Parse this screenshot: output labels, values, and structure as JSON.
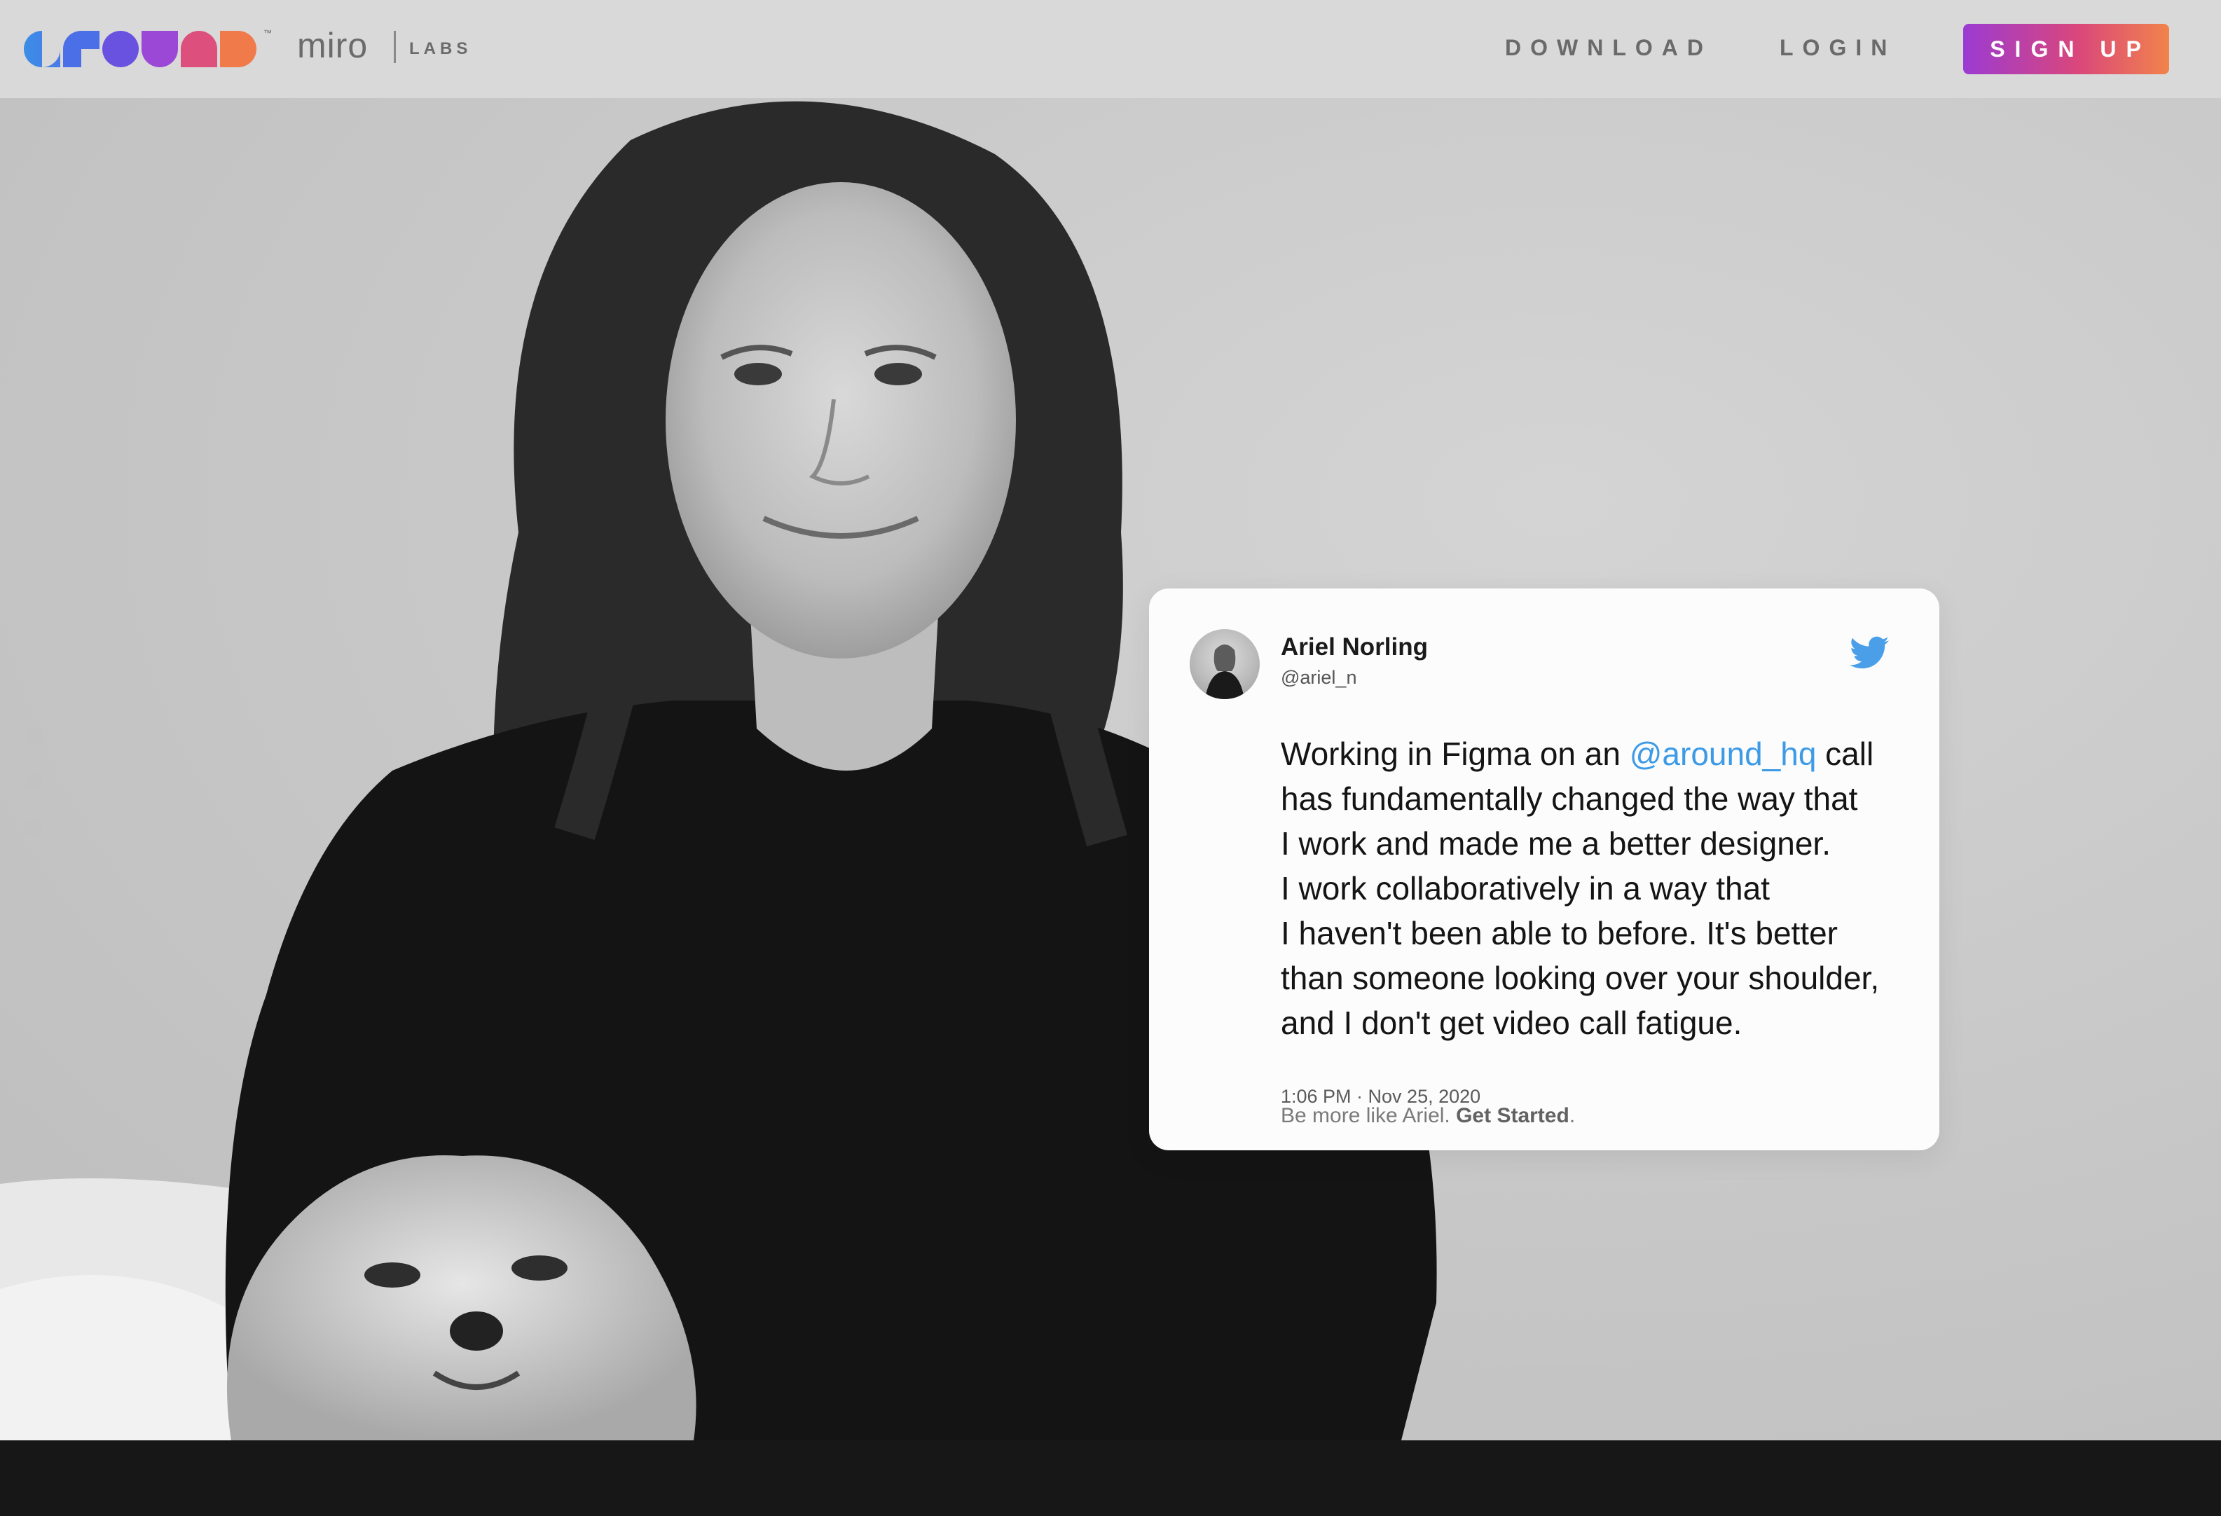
{
  "brand": {
    "logo_text": "around",
    "trademark": "™",
    "partner": "miro",
    "partner_sub": "LABS"
  },
  "nav": {
    "download": "DOWNLOAD",
    "login": "LOGIN",
    "signup": "SIGN UP"
  },
  "tweet": {
    "author": "Ariel Norling",
    "handle": "@ariel_n",
    "lines": [
      {
        "pre": "Working in Figma on an ",
        "mention": "@around_hq",
        "post": " call"
      },
      {
        "pre": "has fundamentally changed the way that",
        "mention": "",
        "post": ""
      },
      {
        "pre": "I work and made me a better designer.",
        "mention": "",
        "post": ""
      },
      {
        "pre": "I work collaboratively in a way that",
        "mention": "",
        "post": ""
      },
      {
        "pre": "I haven't been able to before. It's better",
        "mention": "",
        "post": ""
      },
      {
        "pre": "than someone looking over your shoulder,",
        "mention": "",
        "post": ""
      },
      {
        "pre": "and I don't get video call fatigue.",
        "mention": "",
        "post": ""
      }
    ],
    "timestamp": "1:06 PM · Nov 25, 2020",
    "icon": "twitter-bird-icon"
  },
  "cta": {
    "text": "Be more like Ariel. ",
    "link": "Get Started",
    "end": "."
  },
  "colors": {
    "accent_start": "#9b3bd3",
    "accent_end": "#f2834b",
    "mention": "#3c9ae6",
    "twitter": "#4a9fe8"
  }
}
